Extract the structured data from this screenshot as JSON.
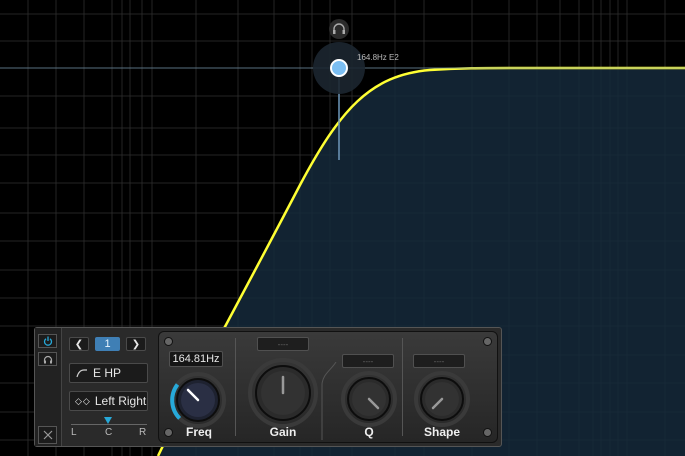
{
  "graph": {
    "node_label": "164.8Hz E2",
    "curve_color": "#ffff33",
    "fill_color": "#15293b",
    "node_color": "#7bbef2"
  },
  "header_icons": [
    "headphones-icon"
  ],
  "band_panel": {
    "band_number": "1",
    "filter_type": "E HP",
    "channel_mode": "Left Right",
    "pan_labels": {
      "left": "L",
      "center": "C",
      "right": "R"
    },
    "power_icon": "power-icon",
    "listen_icon": "headphones-icon",
    "close_icon": "close-icon"
  },
  "knobs": {
    "freq": {
      "label": "Freq",
      "value": "164.81Hz"
    },
    "gain": {
      "label": "Gain",
      "value": "----"
    },
    "q": {
      "label": "Q",
      "value": "----"
    },
    "shape": {
      "label": "Shape",
      "value": "----"
    }
  },
  "colors": {
    "accent": "#27a9d9",
    "background": "#000000"
  }
}
